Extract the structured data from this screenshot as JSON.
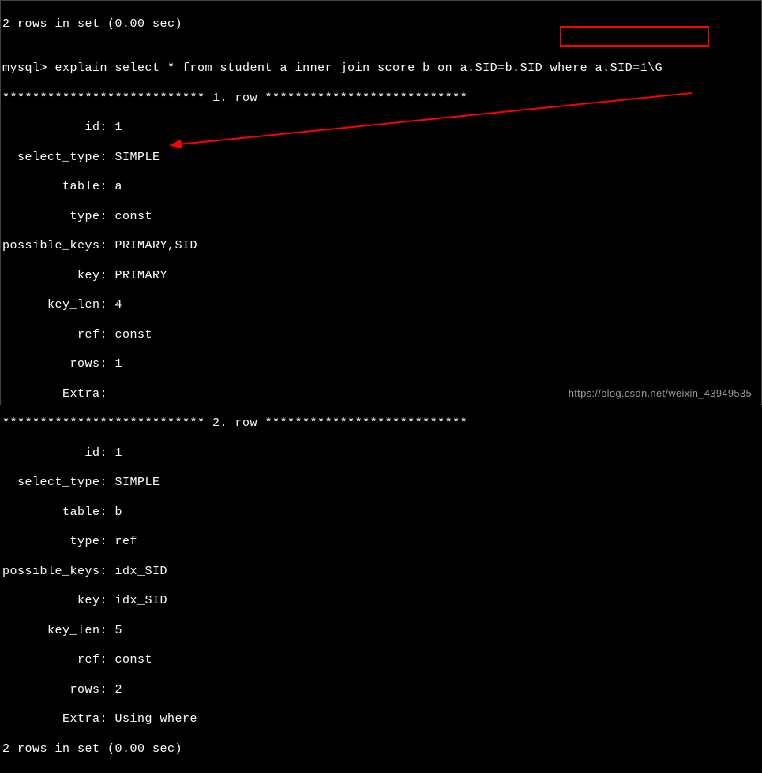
{
  "top_line": "2 rows in set (0.00 sec)",
  "blank": "",
  "prompt": "mysql> ",
  "query_part1": "explain select * from student a inner join score b on a.SID=b.SID ",
  "query_part2": "where a.SID=1\\G",
  "row1_header": "*************************** 1. row ***************************",
  "row1": {
    "id": "           id: 1",
    "select_type": "  select_type: SIMPLE",
    "table": "        table: a",
    "type": "         type: const",
    "possible_keys": "possible_keys: PRIMARY,SID",
    "key": "          key: PRIMARY",
    "key_len": "      key_len: 4",
    "ref": "          ref: const",
    "rows": "         rows: 1",
    "extra": "        Extra:"
  },
  "row2_header": "*************************** 2. row ***************************",
  "row2": {
    "id": "           id: 1",
    "select_type": "  select_type: SIMPLE",
    "table": "        table: b",
    "type": "         type: ref",
    "possible_keys": "possible_keys: idx_SID",
    "key": "          key: idx_SID",
    "key_len": "      key_len: 5",
    "ref": "          ref: const",
    "rows": "         rows: 2",
    "extra": "        Extra: Using where"
  },
  "footer": "2 rows in set (0.00 sec)",
  "watermark": "https://blog.csdn.net/weixin_43949535"
}
